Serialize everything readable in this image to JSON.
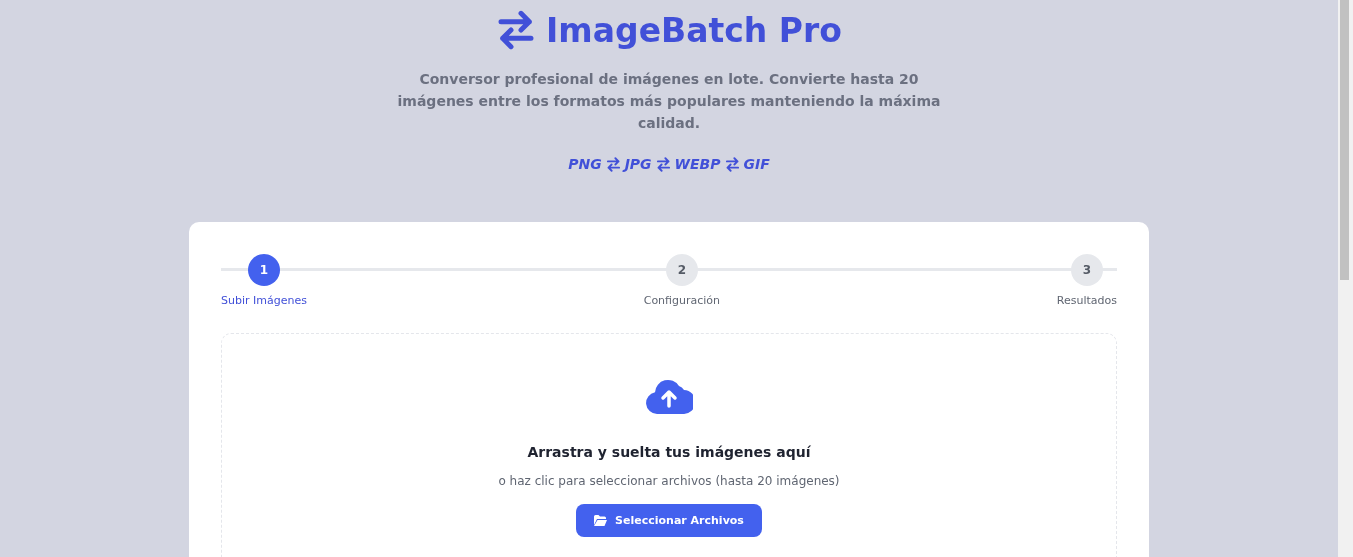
{
  "header": {
    "title": "ImageBatch Pro",
    "description": "Conversor profesional de imágenes en lote. Convierte hasta 20 imágenes entre los formatos más populares manteniendo la máxima calidad.",
    "formats": [
      "PNG",
      "JPG",
      "WEBP",
      "GIF"
    ]
  },
  "steps": [
    {
      "number": "1",
      "label": "Subir Imágenes",
      "active": true
    },
    {
      "number": "2",
      "label": "Configuración",
      "active": false
    },
    {
      "number": "3",
      "label": "Resultados",
      "active": false
    }
  ],
  "dropzone": {
    "heading": "Arrastra y suelta tus imágenes aquí",
    "hint": "o haz clic para seleccionar archivos (hasta 20 imágenes)",
    "button": "Seleccionar Archivos"
  }
}
